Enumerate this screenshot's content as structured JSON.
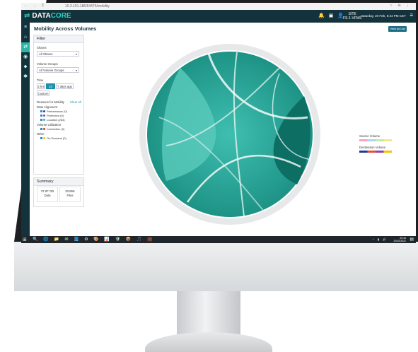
{
  "browser": {
    "nav_icons": "← → C",
    "url": "10.2.151.186/64474/mobility",
    "icons": "☆ ⊖ ⋮"
  },
  "header": {
    "logo_data": "DATA",
    "logo_core": "CORE",
    "site_label": "SITE",
    "site_name": "FS-1-VFMS",
    "datetime": "Saturday, 20 Feb, 8:44 PM CET"
  },
  "page": {
    "title": "Mobility Across Volumes",
    "view_button": "View as List"
  },
  "filter": {
    "title": "Filter",
    "shares_label": "Shares",
    "shares_value": "All Shares",
    "volume_groups_label": "Volume Groups",
    "volume_groups_value": "All Volume Groups",
    "time_label": "Time",
    "time_options": [
      "2 hrs",
      "24 hrs",
      "7 days ago",
      "Custom"
    ],
    "selected_time": "24 hrs",
    "reasons_label": "Reasons for Mobility",
    "clear_all": "Clear All",
    "data_alignment_label": "Data Alignment",
    "alignment_items": [
      {
        "label": "Performance (0)",
        "color": "#2a3f8f"
      },
      {
        "label": "Protection (0)",
        "color": "#8e44ad"
      },
      {
        "label": "Location (264)",
        "color": "#2bb5a6"
      }
    ],
    "volume_util_label": "Volume Utilization",
    "util_items": [
      {
        "label": "Contention (0)",
        "color": "#c0392b"
      }
    ],
    "other_label": "Other",
    "other_items": [
      {
        "label": "On-Demand (0)",
        "color": "#f1c40f"
      }
    ]
  },
  "summary": {
    "title": "Summary",
    "data_value": "37.87 GB",
    "data_label": "Data",
    "files_value": "20.99K",
    "files_label": "Files"
  },
  "legend": {
    "source_label": "Source Volume",
    "source_colors": [
      "#f5a3c7",
      "#a7d8f0",
      "#c8e6a0",
      "#f6e58d"
    ],
    "dest_label": "Destination Volume",
    "dest_colors": [
      "#1e3799",
      "#e74c3c",
      "#8e44ad",
      "#f1c40f"
    ]
  },
  "taskbar": {
    "time": "20:44",
    "date": "20/02/2021"
  }
}
